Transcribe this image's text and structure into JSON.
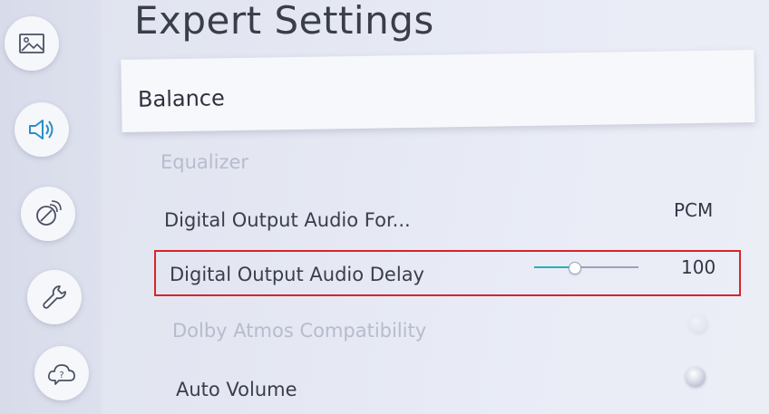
{
  "sidebar": {
    "items": [
      {
        "name": "picture",
        "icon": "picture-icon",
        "active": false
      },
      {
        "name": "sound",
        "icon": "speaker-icon",
        "active": true
      },
      {
        "name": "broadcasting",
        "icon": "satellite-dish-icon",
        "active": false
      },
      {
        "name": "general",
        "icon": "wrench-icon",
        "active": false
      },
      {
        "name": "support",
        "icon": "help-cloud-icon",
        "active": false
      }
    ]
  },
  "header": {
    "title": "Expert Settings"
  },
  "menu": {
    "balance": {
      "label": "Balance",
      "focused": true
    },
    "equalizer": {
      "label": "Equalizer",
      "enabled": false
    },
    "digital_output_format": {
      "label": "Digital Output Audio For...",
      "value": "PCM"
    },
    "digital_output_delay": {
      "label": "Digital Output Audio Delay",
      "value": "100",
      "slider_fraction": 0.38
    },
    "dolby_atmos": {
      "label": "Dolby Atmos Compatibility",
      "enabled": false,
      "toggle_on": false
    },
    "auto_volume": {
      "label": "Auto Volume",
      "toggle_on": false
    }
  },
  "colors": {
    "highlight_border": "#d6252a",
    "accent": "#2bb0b5",
    "active_icon": "#2a8fc4"
  }
}
